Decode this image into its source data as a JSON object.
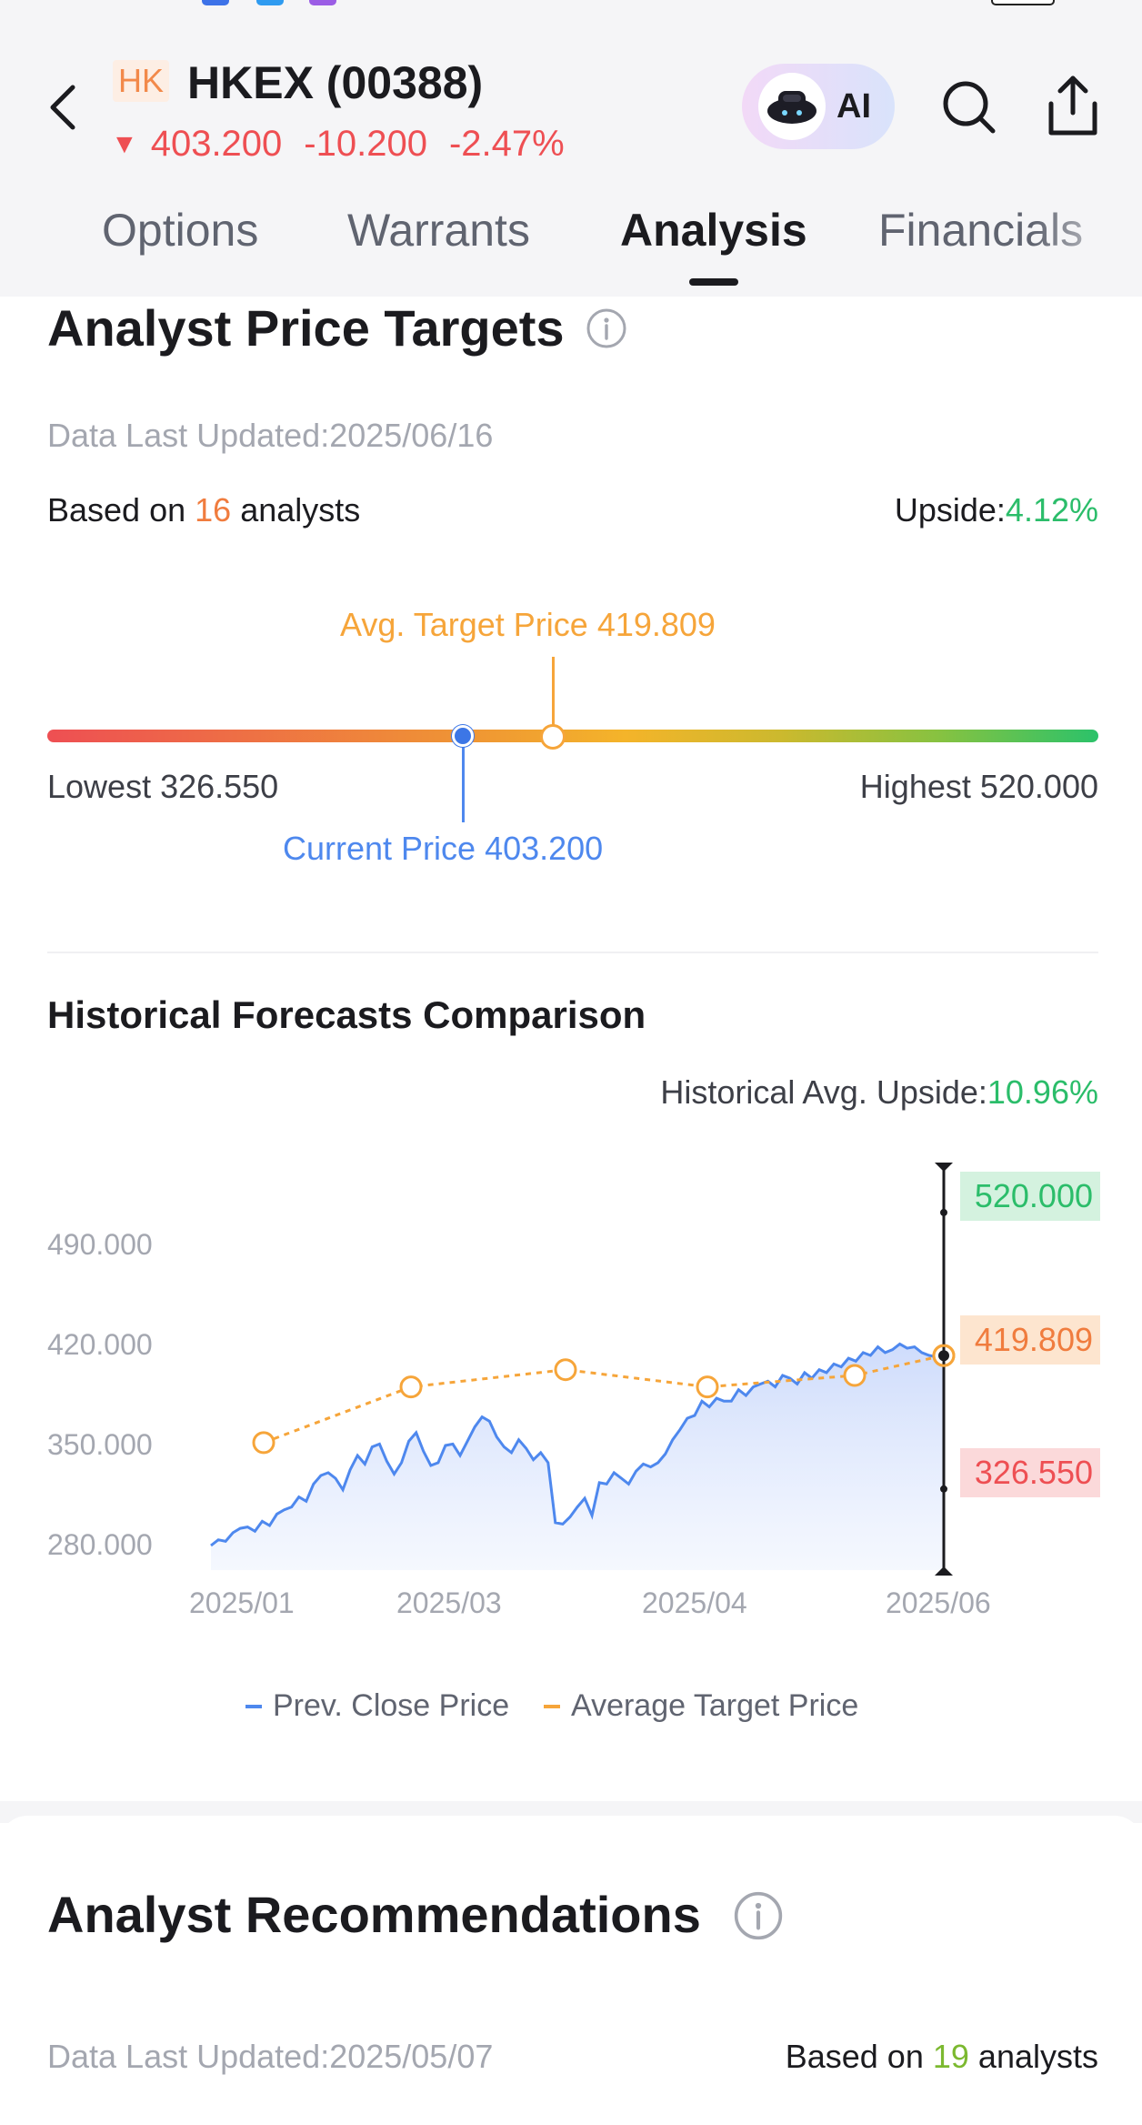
{
  "header": {
    "market_badge": "HK",
    "stock_name": "HKEX (00388)",
    "price": "403.200",
    "change": "-10.200",
    "change_pct": "-2.47%",
    "ai_label": "AI",
    "tabs": [
      "Options",
      "Warrants",
      "Analysis",
      "Financials"
    ],
    "active_tab": "Analysis"
  },
  "price_targets": {
    "title": "Analyst Price Targets",
    "updated": "Data Last Updated:2025/06/16",
    "based_prefix": "Based on",
    "analyst_count": "16",
    "based_suffix": "analysts",
    "upside_label": "Upside:",
    "upside_value": "4.12%",
    "avg_target": "Avg. Target Price 419.809",
    "lowest": "Lowest 326.550",
    "highest": "Highest 520.000",
    "current": "Current Price 403.200",
    "range_values": {
      "low": 326.55,
      "high": 520.0,
      "current": 403.2,
      "avg": 419.809
    }
  },
  "historical": {
    "title": "Historical Forecasts Comparison",
    "avg_upside_label": "Historical Avg. Upside:",
    "avg_upside_value": "10.96%",
    "high_label": "520.000",
    "avg_label": "419.809",
    "low_label": "326.550",
    "legend_close": "Prev. Close Price",
    "legend_target": "Average Target Price"
  },
  "recommendations": {
    "title": "Analyst Recommendations",
    "updated": "Data Last Updated:2025/05/07",
    "based_prefix": "Based on",
    "analyst_count": "19",
    "based_suffix": "analysts"
  },
  "colors": {
    "up": "#2bbd6a",
    "down": "#ee4f53",
    "accent_orange": "#f07c3e",
    "close_line": "#4e88ee",
    "target_line": "#f6a53a"
  },
  "chart_data": {
    "type": "line",
    "y_ticks": [
      "490.000",
      "420.000",
      "350.000",
      "280.000"
    ],
    "x_ticks": [
      "2025/01",
      "2025/03",
      "2025/04",
      "2025/06"
    ],
    "ylim": [
      260,
      540
    ],
    "series": [
      {
        "name": "Prev. Close Price",
        "x_index": [
          0,
          1,
          2,
          3,
          4,
          5,
          6,
          7,
          8,
          9,
          10,
          11,
          12,
          13,
          14,
          15,
          16,
          17,
          18,
          19,
          20,
          21,
          22,
          23,
          24,
          25,
          26,
          27,
          28,
          29,
          30,
          31,
          32,
          33,
          34,
          35,
          36,
          37,
          38,
          39,
          40,
          41,
          42,
          43,
          44,
          45,
          46,
          47,
          48,
          49,
          50,
          51,
          52,
          53,
          54,
          55,
          56,
          57,
          58,
          59,
          60,
          61,
          62,
          63,
          64,
          65,
          66,
          67,
          68,
          69,
          70,
          71,
          72,
          73,
          74,
          75,
          76,
          77,
          78,
          79,
          80,
          81,
          82,
          83,
          84,
          85,
          86,
          87,
          88,
          89,
          90,
          91,
          92,
          93,
          94,
          95,
          96,
          97,
          98,
          99,
          100
        ],
        "values": [
          287,
          291,
          290,
          296,
          299,
          300,
          297,
          304,
          301,
          309,
          312,
          314,
          321,
          318,
          330,
          336,
          338,
          334,
          326,
          340,
          350,
          344,
          356,
          358,
          346,
          337,
          345,
          360,
          366,
          353,
          343,
          345,
          357,
          358,
          350,
          360,
          370,
          377,
          374,
          363,
          356,
          352,
          361,
          355,
          347,
          352,
          345,
          303,
          302,
          307,
          314,
          320,
          308,
          331,
          330,
          338,
          334,
          330,
          339,
          344,
          342,
          345,
          351,
          361,
          368,
          376,
          378,
          388,
          384,
          390,
          388,
          388,
          396,
          392,
          398,
          400,
          402,
          398,
          406,
          404,
          400,
          408,
          404,
          410,
          408,
          414,
          412,
          418,
          416,
          422,
          420,
          426,
          422,
          424,
          428,
          425,
          426,
          422,
          420,
          419,
          424
        ]
      },
      {
        "name": "Average Target Price",
        "points": [
          {
            "x": "2025/01",
            "y": 359
          },
          {
            "x": "2025/02",
            "y": 398
          },
          {
            "x": "2025/03",
            "y": 410
          },
          {
            "x": "2025/04",
            "y": 398
          },
          {
            "x": "2025/05",
            "y": 406
          },
          {
            "x": "2025/06",
            "y": 420
          }
        ]
      }
    ],
    "markers": {
      "high": 520.0,
      "avg": 419.809,
      "low": 326.55
    }
  }
}
